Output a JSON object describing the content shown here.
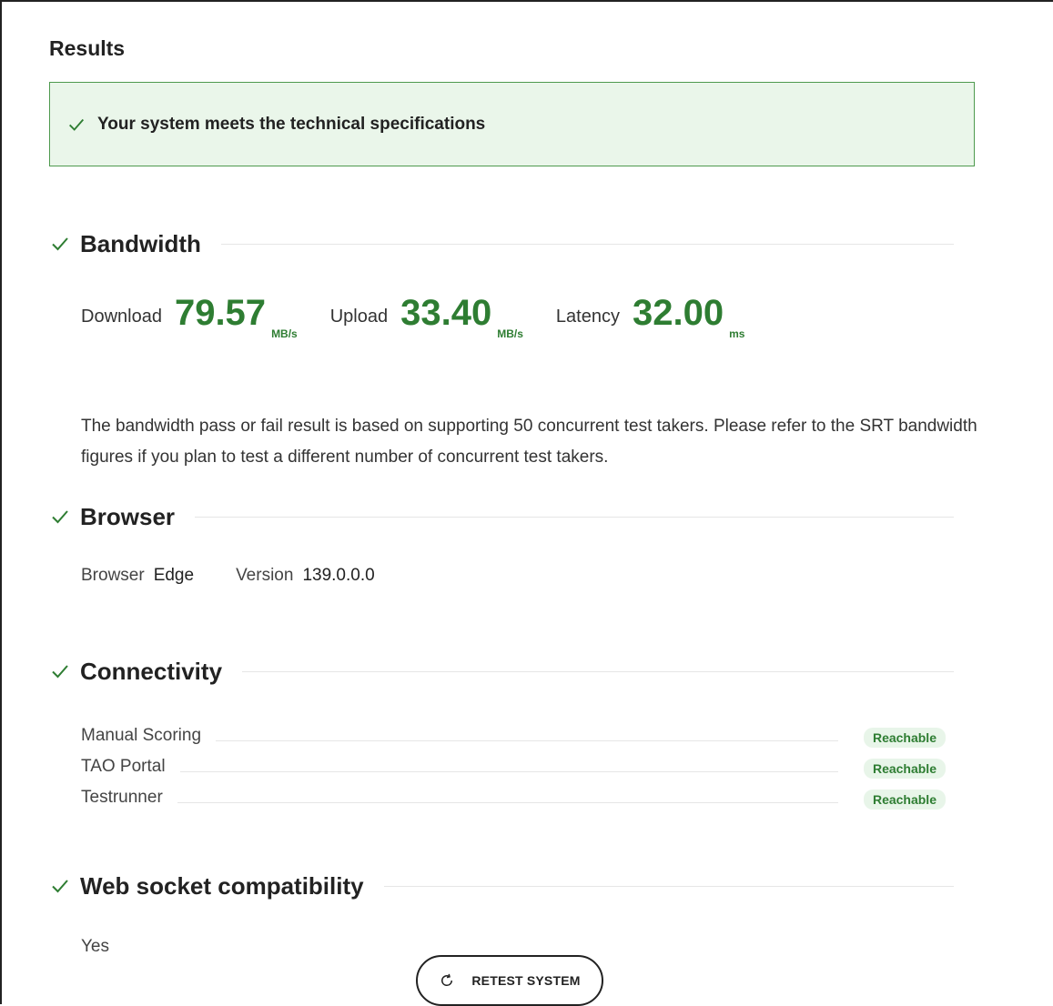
{
  "results": {
    "title": "Results",
    "banner": "Your system meets the technical specifications"
  },
  "bandwidth": {
    "title": "Bandwidth",
    "metrics": [
      {
        "label": "Download",
        "value": "79.57",
        "unit": "MB/s"
      },
      {
        "label": "Upload",
        "value": "33.40",
        "unit": "MB/s"
      },
      {
        "label": "Latency",
        "value": "32.00",
        "unit": "ms"
      }
    ],
    "note": "The bandwidth pass or fail result is based on supporting 50 concurrent test takers. Please refer to the SRT bandwidth figures if you plan to test a different number of concurrent test takers."
  },
  "browser": {
    "title": "Browser",
    "browser_label": "Browser",
    "browser_value": "Edge",
    "version_label": "Version",
    "version_value": "139.0.0.0"
  },
  "connectivity": {
    "title": "Connectivity",
    "items": [
      {
        "name": "Manual Scoring",
        "status": "Reachable"
      },
      {
        "name": "TAO Portal",
        "status": "Reachable"
      },
      {
        "name": "Testrunner",
        "status": "Reachable"
      }
    ]
  },
  "websocket": {
    "title": "Web socket compatibility",
    "value": "Yes"
  },
  "retest_button": {
    "label": "RETEST SYSTEM",
    "icon": "refresh-icon"
  },
  "colors": {
    "success_green": "#2e7d32",
    "banner_bg": "#eaf6ea",
    "banner_border": "#4e9a4e",
    "badge_bg": "#e8f5e9"
  }
}
